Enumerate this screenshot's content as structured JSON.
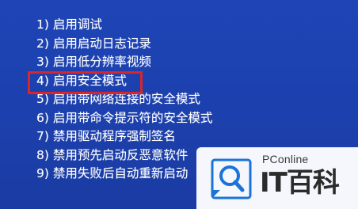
{
  "boot_menu": {
    "items": [
      {
        "num": "1)",
        "label": "启用调试"
      },
      {
        "num": "2)",
        "label": "启用启动日志记录"
      },
      {
        "num": "3)",
        "label": "启用低分辨率视频"
      },
      {
        "num": "4)",
        "label": "启用安全模式"
      },
      {
        "num": "5)",
        "label": "启用带网络连接的安全模式"
      },
      {
        "num": "6)",
        "label": "启用带命令提示符的安全模式"
      },
      {
        "num": "7)",
        "label": "禁用驱动程序强制签名"
      },
      {
        "num": "8)",
        "label": "禁用预先启动反恶意软件"
      },
      {
        "num": "9)",
        "label": "禁用失败后自动重新启动"
      }
    ],
    "highlighted_index": 3,
    "highlight_color": "#d8262c",
    "background_color": "#1c40ad"
  },
  "watermark": {
    "brand": "PConline",
    "title": "IT百科",
    "icon": "magnifier-logo-icon",
    "accent_color": "#1a73d9"
  }
}
